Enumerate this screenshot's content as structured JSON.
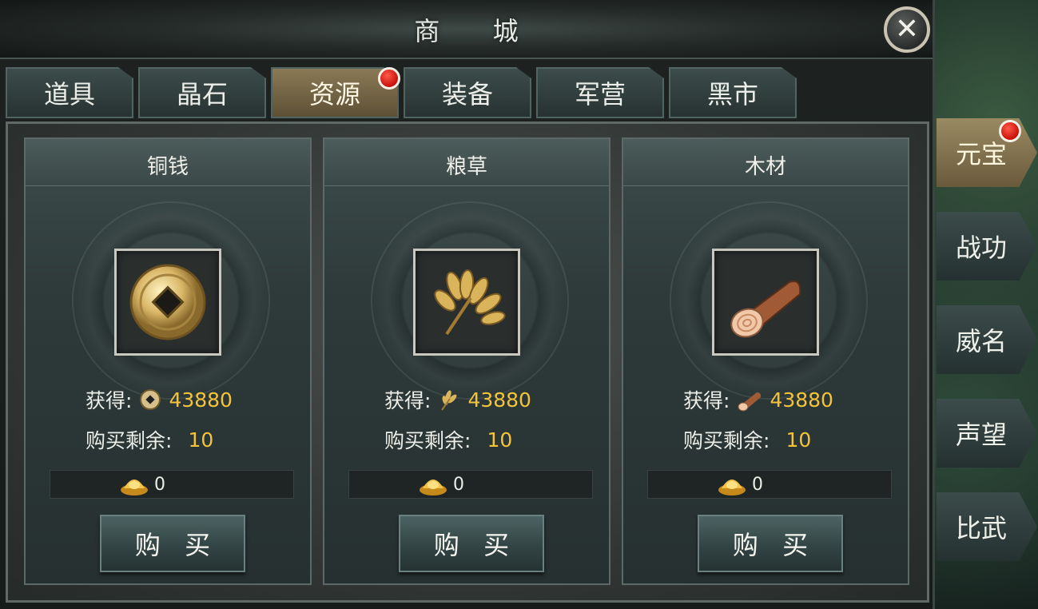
{
  "window": {
    "title": "商 城"
  },
  "tabs": [
    {
      "label": "道具",
      "active": false,
      "badge": false
    },
    {
      "label": "晶石",
      "active": false,
      "badge": false
    },
    {
      "label": "资源",
      "active": true,
      "badge": true
    },
    {
      "label": "装备",
      "active": false,
      "badge": false
    },
    {
      "label": "军营",
      "active": false,
      "badge": false
    },
    {
      "label": "黑市",
      "active": false,
      "badge": false
    }
  ],
  "cards": [
    {
      "name": "铜钱",
      "icon": "copper-coin-icon",
      "gain_label": "获得:",
      "gain_value": "43880",
      "remain_label": "购买剩余:",
      "remain_value": "10",
      "price": "0",
      "buy_label": "购 买"
    },
    {
      "name": "粮草",
      "icon": "grain-icon",
      "gain_label": "获得:",
      "gain_value": "43880",
      "remain_label": "购买剩余:",
      "remain_value": "10",
      "price": "0",
      "buy_label": "购 买"
    },
    {
      "name": "木材",
      "icon": "wood-log-icon",
      "gain_label": "获得:",
      "gain_value": "43880",
      "remain_label": "购买剩余:",
      "remain_value": "10",
      "price": "0",
      "buy_label": "购 买"
    }
  ],
  "side_tabs": [
    {
      "label": "元宝",
      "active": true,
      "badge": true
    },
    {
      "label": "战功",
      "active": false,
      "badge": false
    },
    {
      "label": "威名",
      "active": false,
      "badge": false
    },
    {
      "label": "声望",
      "active": false,
      "badge": false
    },
    {
      "label": "比武",
      "active": false,
      "badge": false
    }
  ],
  "colors": {
    "value_gold": "#f4c33a",
    "badge_red": "#d8140c",
    "active_tab": "#8b7b56"
  }
}
